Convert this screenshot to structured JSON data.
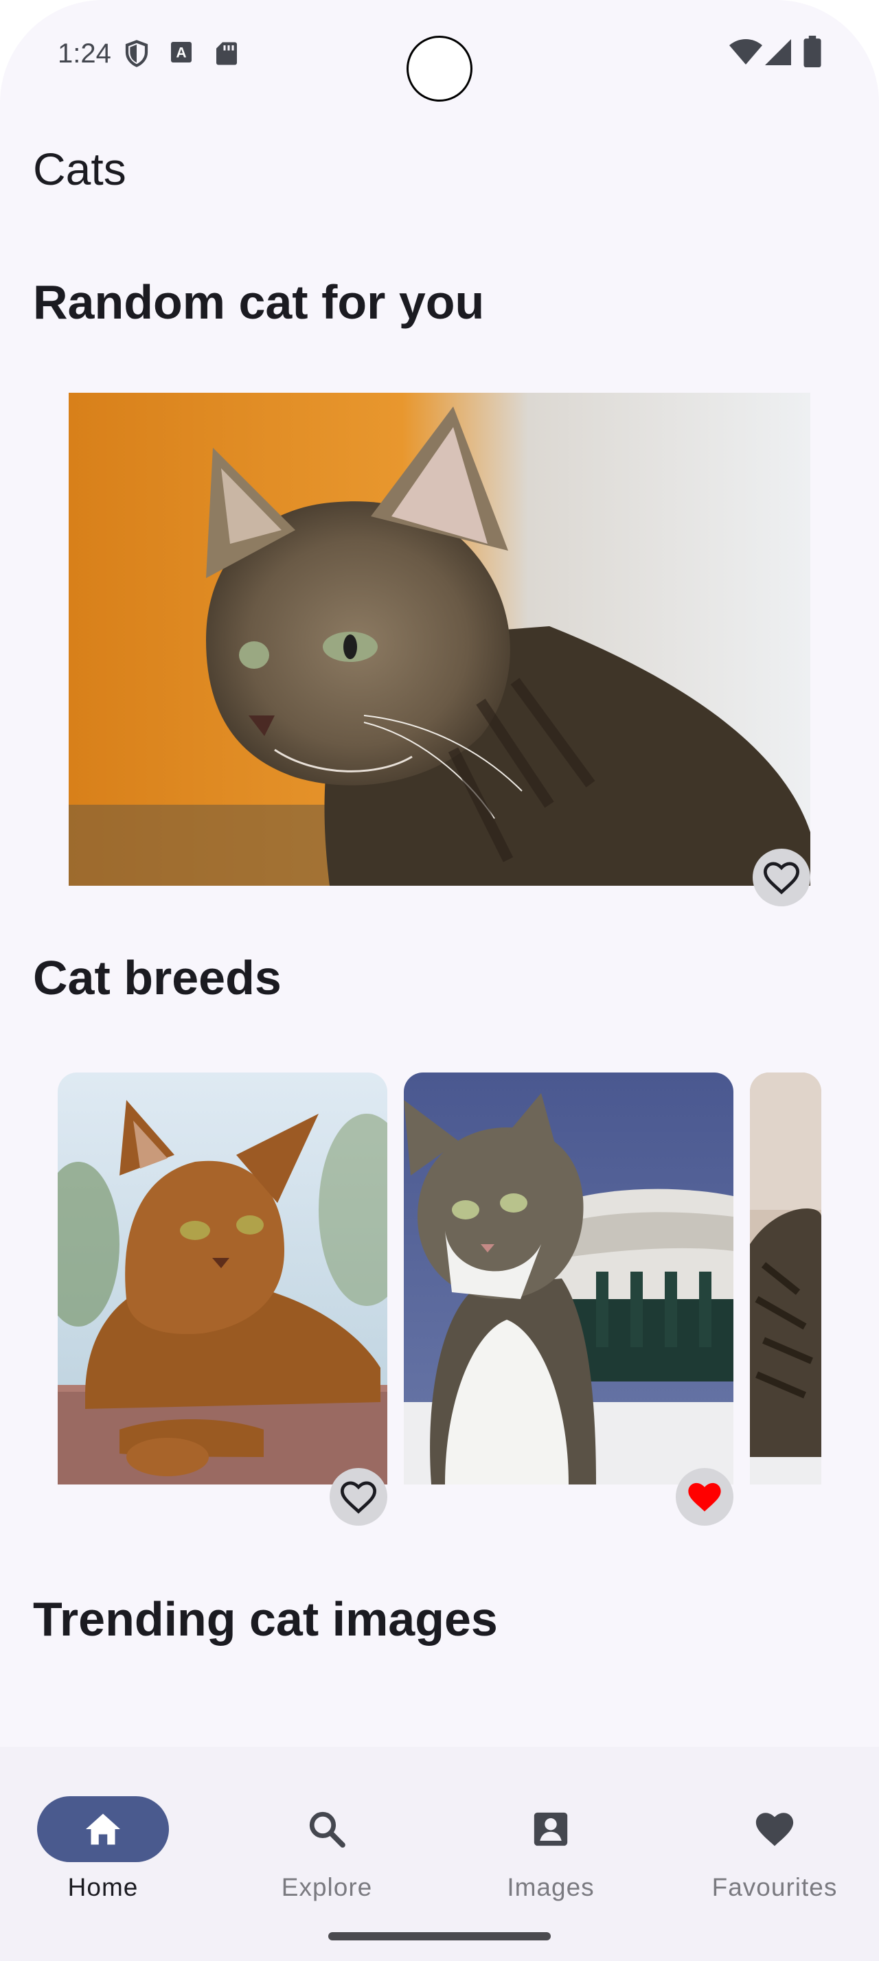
{
  "status_bar": {
    "time": "1:24"
  },
  "app_bar": {
    "title": "Cats"
  },
  "sections": {
    "random": {
      "heading": "Random cat for you",
      "favourite": false
    },
    "breeds": {
      "heading": "Cat breeds",
      "cards": [
        {
          "name": "abyssinian-cat",
          "favourite": false
        },
        {
          "name": "tabby-white-cat",
          "favourite": true
        },
        {
          "name": "tabby-cat-partial",
          "favourite": false
        }
      ]
    },
    "trending": {
      "heading": "Trending cat images"
    }
  },
  "bottom_nav": {
    "items": [
      {
        "label": "Home",
        "icon": "home-icon",
        "active": true
      },
      {
        "label": "Explore",
        "icon": "search-icon",
        "active": false
      },
      {
        "label": "Images",
        "icon": "account-box-icon",
        "active": false
      },
      {
        "label": "Favourites",
        "icon": "heart-icon",
        "active": false
      }
    ]
  },
  "colors": {
    "background": "#f8f6fc",
    "active_pill": "#4a5a8e",
    "favourite_active": "#ff0000",
    "favourite_button_bg": "#d6d6da"
  }
}
